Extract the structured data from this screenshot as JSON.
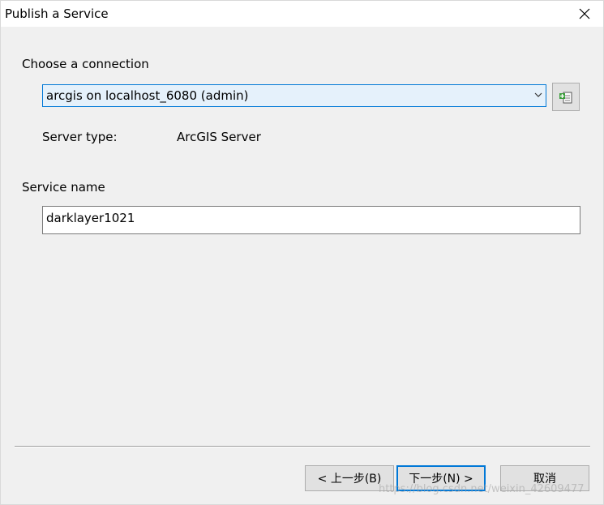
{
  "window": {
    "title": "Publish a Service",
    "close_glyph": "close-icon"
  },
  "connection": {
    "label": "Choose a connection",
    "selected": "arcgis on localhost_6080 (admin)",
    "button_icon": "add-connection-icon"
  },
  "server": {
    "type_label": "Server type:",
    "type_value": "ArcGIS Server"
  },
  "service": {
    "label": "Service name",
    "value": "darklayer1021"
  },
  "buttons": {
    "back": "< 上一步(B)",
    "next": "下一步(N) >",
    "cancel": "取消"
  },
  "watermark": "https://blog.csdn.net/weixin_42609477",
  "colors": {
    "accent": "#0078d7",
    "combo_bg": "#e5f1fb",
    "dialog_bg": "#f0f0f0"
  }
}
